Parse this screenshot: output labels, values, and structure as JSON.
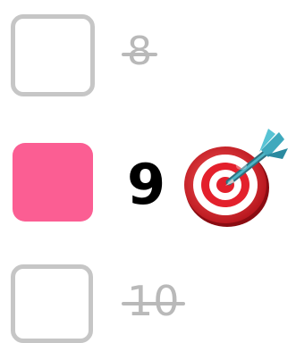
{
  "items": [
    {
      "number": "8",
      "checked": false,
      "struck_through": true
    },
    {
      "number": "9",
      "checked": true,
      "struck_through": false,
      "emoji": "direct-hit-dart-icon"
    },
    {
      "number": "10",
      "checked": false,
      "struck_through": true
    }
  ],
  "colors": {
    "checked_fill": "#fb5e93",
    "unchecked_border": "#c6c6c6",
    "struck_text": "#b9b9b9",
    "active_text": "#000000"
  }
}
